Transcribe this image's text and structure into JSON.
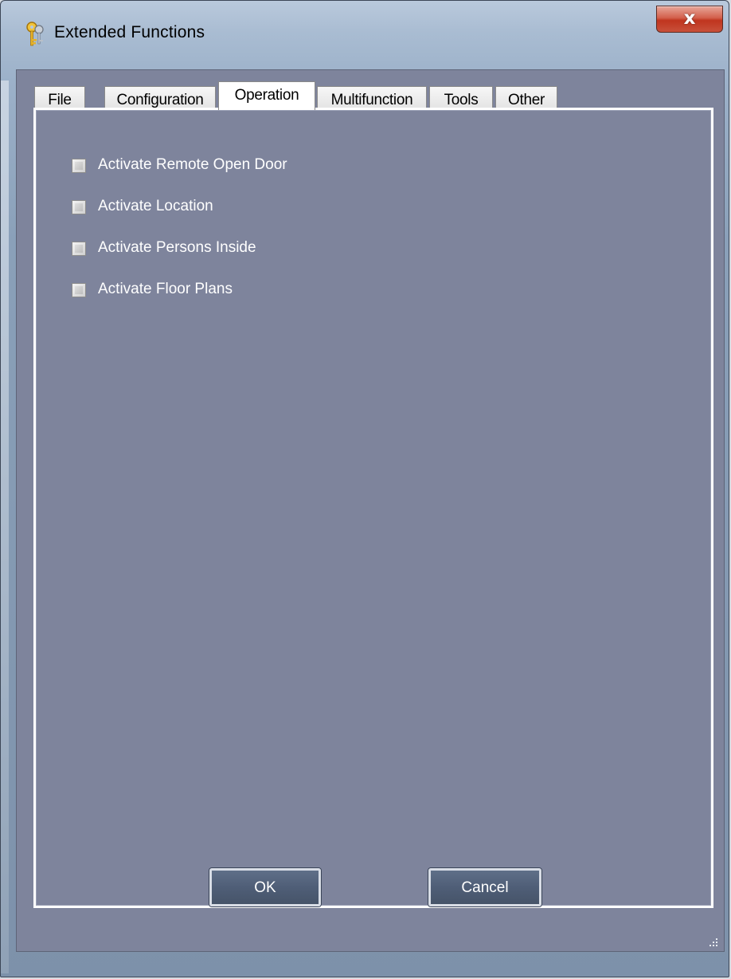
{
  "window": {
    "title": "Extended Functions",
    "close_label": "x",
    "icon": "keys-icon"
  },
  "tabs": [
    {
      "label": "File",
      "active": false
    },
    {
      "label": "Configuration",
      "active": false
    },
    {
      "label": "Operation",
      "active": true
    },
    {
      "label": "Multifunction",
      "active": false
    },
    {
      "label": "Tools",
      "active": false
    },
    {
      "label": "Other",
      "active": false
    }
  ],
  "options": [
    {
      "label": "Activate Remote Open Door",
      "checked": false
    },
    {
      "label": "Activate Location",
      "checked": false
    },
    {
      "label": "Activate Persons Inside",
      "checked": false
    },
    {
      "label": "Activate Floor Plans",
      "checked": false
    }
  ],
  "buttons": {
    "ok": "OK",
    "cancel": "Cancel"
  },
  "colors": {
    "panel_bg": "#7e849c",
    "button_bg": "#4f5e77",
    "close_red": "#c8503a"
  }
}
